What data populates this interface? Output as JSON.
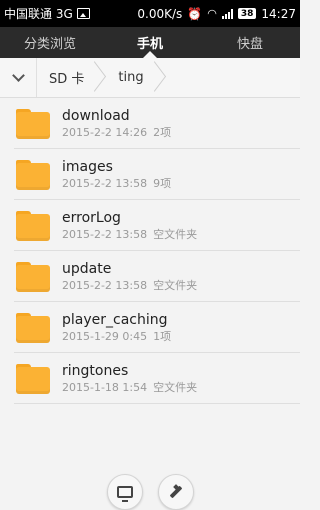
{
  "status_bar": {
    "carrier": "中国联通 3G",
    "speed": "0.00K/s",
    "battery": "38",
    "time": "14:27"
  },
  "tabs": [
    {
      "label": "分类浏览",
      "active": false
    },
    {
      "label": "手机",
      "active": true
    },
    {
      "label": "快盘",
      "active": false
    }
  ],
  "breadcrumb": [
    "SD 卡",
    "ting"
  ],
  "files": [
    {
      "name": "download",
      "date": "2015-2-2 14:26",
      "info": "2项"
    },
    {
      "name": "images",
      "date": "2015-2-2 13:58",
      "info": "9项"
    },
    {
      "name": "errorLog",
      "date": "2015-2-2 13:58",
      "info": "空文件夹"
    },
    {
      "name": "update",
      "date": "2015-2-2 13:58",
      "info": "空文件夹"
    },
    {
      "name": "player_caching",
      "date": "2015-1-29 0:45",
      "info": "1项"
    },
    {
      "name": "ringtones",
      "date": "2015-1-18 1:54",
      "info": "空文件夹"
    }
  ],
  "colors": {
    "tab_bar": "#2b2b2b",
    "folder": "#fbb234",
    "background": "#f3f3f3"
  },
  "icons": {
    "bottom_left": "remote-screen-icon",
    "bottom_right": "clean-icon"
  }
}
